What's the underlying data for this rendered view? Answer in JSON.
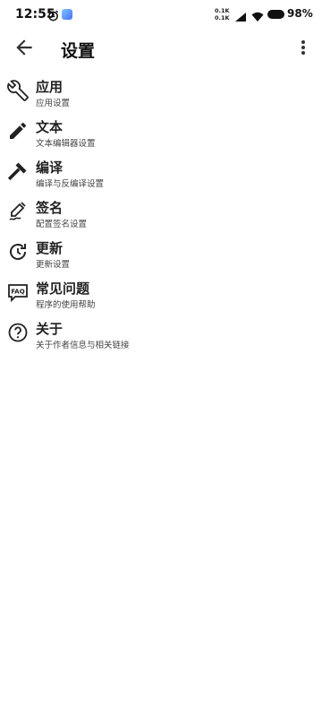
{
  "status_bar": {
    "time": "12:55",
    "net_speed_up": "0.1K",
    "net_speed_down": "0.1K",
    "battery": "98%"
  },
  "app_bar": {
    "title": "设置",
    "back_icon": "arrow-back-icon",
    "more_icon": "more-vert-icon"
  },
  "settings": [
    {
      "icon": "wrench-icon",
      "title": "应用",
      "subtitle": "应用设置"
    },
    {
      "icon": "pencil-icon",
      "title": "文本",
      "subtitle": "文本编辑器设置"
    },
    {
      "icon": "hammer-icon",
      "title": "编译",
      "subtitle": "编译与反编译设置"
    },
    {
      "icon": "signature-icon",
      "title": "签名",
      "subtitle": "配置签名设置"
    },
    {
      "icon": "update-icon",
      "title": "更新",
      "subtitle": "更新设置"
    },
    {
      "icon": "faq-icon",
      "title": "常见问题",
      "subtitle": "程序的使用帮助"
    },
    {
      "icon": "help-circle-icon",
      "title": "关于",
      "subtitle": "关于作者信息与相关链接"
    }
  ]
}
